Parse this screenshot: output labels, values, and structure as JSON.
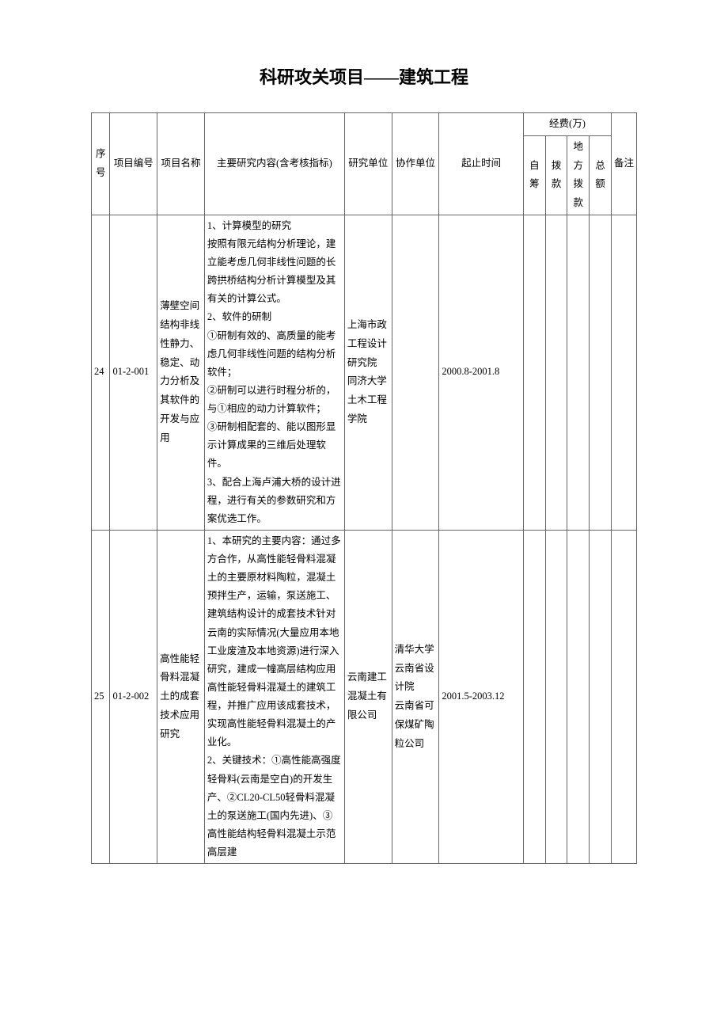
{
  "title": "科研攻关项目——建筑工程",
  "header": {
    "seq": "序号",
    "code": "项目编号",
    "name": "项目名称",
    "content": "主要研究内容(含考核指标)",
    "unit": "研究单位",
    "partner": "协作单位",
    "time": "起止时间",
    "funds_group": "经费(万)",
    "self": "自筹",
    "allocation": "拨款",
    "local": "地方拨款",
    "total": "总额",
    "note": "备注"
  },
  "rows": [
    {
      "seq": "24",
      "code": "01-2-001",
      "name": "薄壁空间结构非线性静力、稳定、动力分析及其软件的开发与应用",
      "content": "1、计算模型的研究\n按照有限元结构分析理论，建立能考虑几何非线性问题的长跨拱桥结构分析计算模型及其有关的计算公式。\n2、软件的研制\n①研制有效的、高质量的能考虑几何非线性问题的结构分析软件；\n②研制可以进行时程分析的，与①相应的动力计算软件；\n③研制相配套的、能以图形显示计算成果的三维后处理软件。\n3、配合上海卢浦大桥的设计进程，进行有关的参数研究和方案优选工作。",
      "unit": "上海市政工程设计研究院\n同济大学土木工程学院",
      "partner": "",
      "time": "2000.8-2001.8",
      "self": "",
      "allocation": "",
      "local": "",
      "total": "",
      "note": ""
    },
    {
      "seq": "25",
      "code": "01-2-002",
      "name": "高性能轻骨料混凝土的成套技术应用研究",
      "content": "1、本研究的主要内容：通过多方合作，从高性能轻骨料混凝土的主要原材料陶粒，混凝土预拌生产，运输，泵送施工、建筑结构设计的成套技术针对云南的实际情况(大量应用本地工业废渣及本地资源)进行深入研究，建成一幢高层结构应用高性能轻骨料混凝土的建筑工程，并推广应用该成套技术，实现高性能轻骨料混凝土的产业化。\n2、关键技术：①高性能高强度轻骨料(云南是空白)的开发生产、②CL20-CL50轻骨料混凝土的泵送施工(国内先进)、③高性能结构轻骨料混凝土示范高层建",
      "unit": "云南建工混凝土有限公司",
      "partner": "清华大学\n云南省设计院\n云南省可保煤矿陶粒公司",
      "time": "2001.5-2003.12",
      "self": "",
      "allocation": "",
      "local": "",
      "total": "",
      "note": ""
    }
  ]
}
